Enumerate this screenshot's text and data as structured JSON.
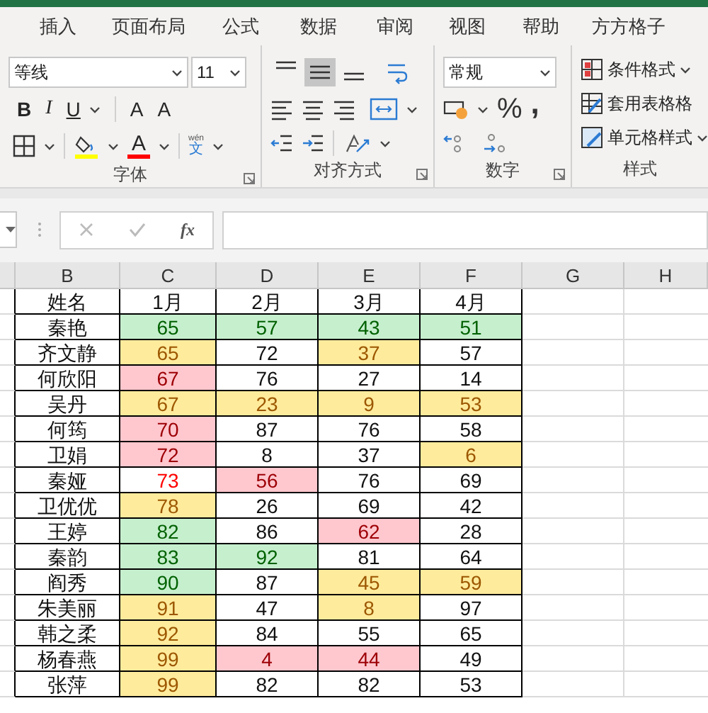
{
  "tabs": [
    {
      "label": "插入"
    },
    {
      "label": "页面布局"
    },
    {
      "label": "公式"
    },
    {
      "label": "数据"
    },
    {
      "label": "审阅"
    },
    {
      "label": "视图"
    },
    {
      "label": "帮助"
    },
    {
      "label": "方方格子"
    }
  ],
  "font_group": {
    "font_name": "等线",
    "font_size": "11",
    "bold": "B",
    "italic": "I",
    "underline": "U",
    "grow": "A",
    "shrink": "A",
    "font_color": "A",
    "phonetic_top": "wén",
    "phonetic_bottom": "文",
    "label": "字体"
  },
  "alignment_group": {
    "vertical": [
      {
        "kind": "top",
        "selected": false
      },
      {
        "kind": "middle",
        "selected": true
      },
      {
        "kind": "bottom",
        "selected": false
      }
    ],
    "label": "对齐方式"
  },
  "number_group": {
    "format": "常规",
    "percent": "%",
    "comma": ",",
    "label": "数字"
  },
  "styles_group": {
    "buttons": [
      {
        "kind": "conditional",
        "label": "条件格式"
      },
      {
        "kind": "table",
        "label": "套用表格格"
      },
      {
        "kind": "cell",
        "label": "单元格样式"
      }
    ],
    "label": "样式"
  },
  "formula_bar": {
    "fx": "fx"
  },
  "columns": [
    "B",
    "C",
    "D",
    "E",
    "F",
    "G",
    "H"
  ],
  "table": {
    "header": [
      "姓名",
      "1月",
      "2月",
      "3月",
      "4月"
    ],
    "rows": [
      {
        "name": "秦艳",
        "cells": [
          {
            "value": "65",
            "kind": "good"
          },
          {
            "value": "57",
            "kind": "good"
          },
          {
            "value": "43",
            "kind": "good"
          },
          {
            "value": "51",
            "kind": "good"
          }
        ]
      },
      {
        "name": "齐文静",
        "cells": [
          {
            "value": "65",
            "kind": "neutral"
          },
          {
            "value": "72",
            "kind": "normal"
          },
          {
            "value": "37",
            "kind": "neutral"
          },
          {
            "value": "57",
            "kind": "normal"
          }
        ]
      },
      {
        "name": "何欣阳",
        "cells": [
          {
            "value": "67",
            "kind": "bad"
          },
          {
            "value": "76",
            "kind": "normal"
          },
          {
            "value": "27",
            "kind": "normal"
          },
          {
            "value": "14",
            "kind": "normal"
          }
        ]
      },
      {
        "name": "吴丹",
        "cells": [
          {
            "value": "67",
            "kind": "neutral"
          },
          {
            "value": "23",
            "kind": "neutral"
          },
          {
            "value": "9",
            "kind": "neutral"
          },
          {
            "value": "53",
            "kind": "neutral"
          }
        ]
      },
      {
        "name": "何筠",
        "cells": [
          {
            "value": "70",
            "kind": "bad"
          },
          {
            "value": "87",
            "kind": "normal"
          },
          {
            "value": "76",
            "kind": "normal"
          },
          {
            "value": "58",
            "kind": "normal"
          }
        ]
      },
      {
        "name": "卫娟",
        "cells": [
          {
            "value": "72",
            "kind": "bad"
          },
          {
            "value": "8",
            "kind": "normal"
          },
          {
            "value": "37",
            "kind": "normal"
          },
          {
            "value": "6",
            "kind": "neutral"
          }
        ]
      },
      {
        "name": "秦娅",
        "cells": [
          {
            "value": "73",
            "kind": "red_text"
          },
          {
            "value": "56",
            "kind": "bad"
          },
          {
            "value": "76",
            "kind": "normal"
          },
          {
            "value": "69",
            "kind": "normal"
          }
        ]
      },
      {
        "name": "卫优优",
        "cells": [
          {
            "value": "78",
            "kind": "neutral"
          },
          {
            "value": "26",
            "kind": "normal"
          },
          {
            "value": "69",
            "kind": "normal"
          },
          {
            "value": "42",
            "kind": "normal"
          }
        ]
      },
      {
        "name": "王婷",
        "cells": [
          {
            "value": "82",
            "kind": "good"
          },
          {
            "value": "86",
            "kind": "normal"
          },
          {
            "value": "62",
            "kind": "bad"
          },
          {
            "value": "28",
            "kind": "normal"
          }
        ]
      },
      {
        "name": "秦韵",
        "cells": [
          {
            "value": "83",
            "kind": "good"
          },
          {
            "value": "92",
            "kind": "good"
          },
          {
            "value": "81",
            "kind": "normal"
          },
          {
            "value": "64",
            "kind": "normal"
          }
        ]
      },
      {
        "name": "阎秀",
        "cells": [
          {
            "value": "90",
            "kind": "good"
          },
          {
            "value": "87",
            "kind": "normal"
          },
          {
            "value": "45",
            "kind": "neutral"
          },
          {
            "value": "59",
            "kind": "neutral"
          }
        ]
      },
      {
        "name": "朱美丽",
        "cells": [
          {
            "value": "91",
            "kind": "neutral"
          },
          {
            "value": "47",
            "kind": "normal"
          },
          {
            "value": "8",
            "kind": "neutral"
          },
          {
            "value": "97",
            "kind": "normal"
          }
        ]
      },
      {
        "name": "韩之柔",
        "cells": [
          {
            "value": "92",
            "kind": "neutral"
          },
          {
            "value": "84",
            "kind": "normal"
          },
          {
            "value": "55",
            "kind": "normal"
          },
          {
            "value": "65",
            "kind": "normal"
          }
        ]
      },
      {
        "name": "杨春燕",
        "cells": [
          {
            "value": "99",
            "kind": "neutral"
          },
          {
            "value": "4",
            "kind": "bad"
          },
          {
            "value": "44",
            "kind": "bad"
          },
          {
            "value": "49",
            "kind": "normal"
          }
        ]
      },
      {
        "name": "张萍",
        "cells": [
          {
            "value": "99",
            "kind": "neutral"
          },
          {
            "value": "82",
            "kind": "normal"
          },
          {
            "value": "82",
            "kind": "normal"
          },
          {
            "value": "53",
            "kind": "normal"
          }
        ]
      }
    ]
  }
}
